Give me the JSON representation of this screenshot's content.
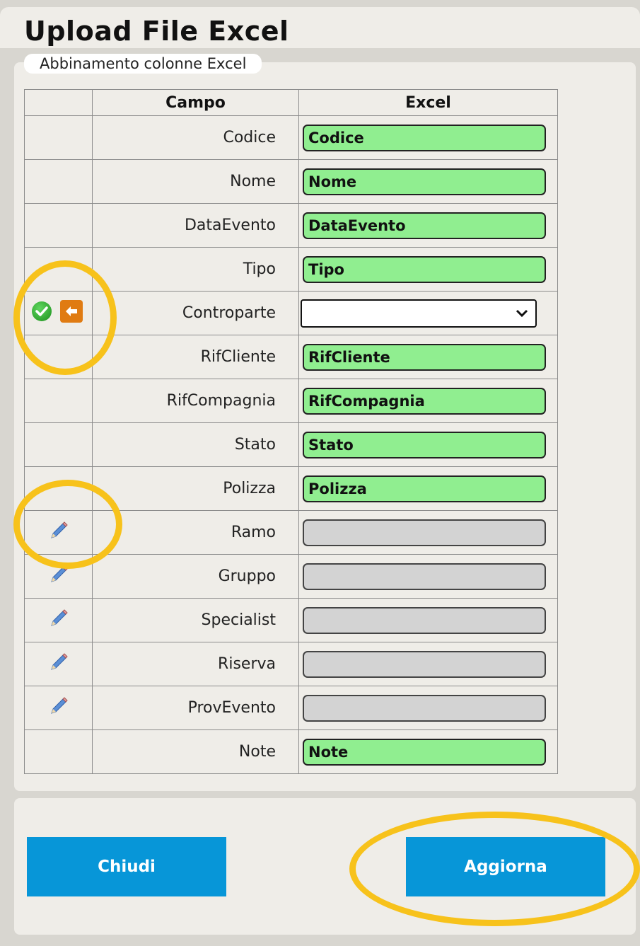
{
  "window": {
    "title": "Upload File Excel"
  },
  "panel": {
    "legend": "Abbinamento colonne Excel"
  },
  "table": {
    "headers": {
      "icon": "",
      "campo": "Campo",
      "excel": "Excel"
    },
    "rows": [
      {
        "campo": "Codice",
        "excel": "Codice",
        "state": "mapped",
        "icons": []
      },
      {
        "campo": "Nome",
        "excel": "Nome",
        "state": "mapped",
        "icons": []
      },
      {
        "campo": "DataEvento",
        "excel": "DataEvento",
        "state": "mapped",
        "icons": []
      },
      {
        "campo": "Tipo",
        "excel": "Tipo",
        "state": "mapped",
        "icons": []
      },
      {
        "campo": "Controparte",
        "excel": "",
        "state": "select",
        "icons": [
          "check-icon",
          "arrow-left-icon"
        ]
      },
      {
        "campo": "RifCliente",
        "excel": "RifCliente",
        "state": "mapped",
        "icons": []
      },
      {
        "campo": "RifCompagnia",
        "excel": "RifCompagnia",
        "state": "mapped",
        "icons": []
      },
      {
        "campo": "Stato",
        "excel": "Stato",
        "state": "mapped",
        "icons": []
      },
      {
        "campo": "Polizza",
        "excel": "Polizza",
        "state": "mapped",
        "icons": []
      },
      {
        "campo": "Ramo",
        "excel": "",
        "state": "empty",
        "icons": [
          "pencil-icon"
        ]
      },
      {
        "campo": "Gruppo",
        "excel": "",
        "state": "empty",
        "icons": [
          "pencil-icon"
        ]
      },
      {
        "campo": "Specialist",
        "excel": "",
        "state": "empty",
        "icons": [
          "pencil-icon"
        ]
      },
      {
        "campo": "Riserva",
        "excel": "",
        "state": "empty",
        "icons": [
          "pencil-icon"
        ]
      },
      {
        "campo": "ProvEvento",
        "excel": "",
        "state": "empty",
        "icons": [
          "pencil-icon"
        ]
      },
      {
        "campo": "Note",
        "excel": "Note",
        "state": "mapped",
        "icons": []
      }
    ]
  },
  "footer": {
    "close_label": "Chiudi",
    "update_label": "Aggiorna"
  },
  "colors": {
    "mapped_field": "#90ee90",
    "empty_field": "#d3d3d3",
    "button": "#0796d8",
    "highlight": "#f7c21b",
    "arrow_icon": "#e07b12"
  }
}
